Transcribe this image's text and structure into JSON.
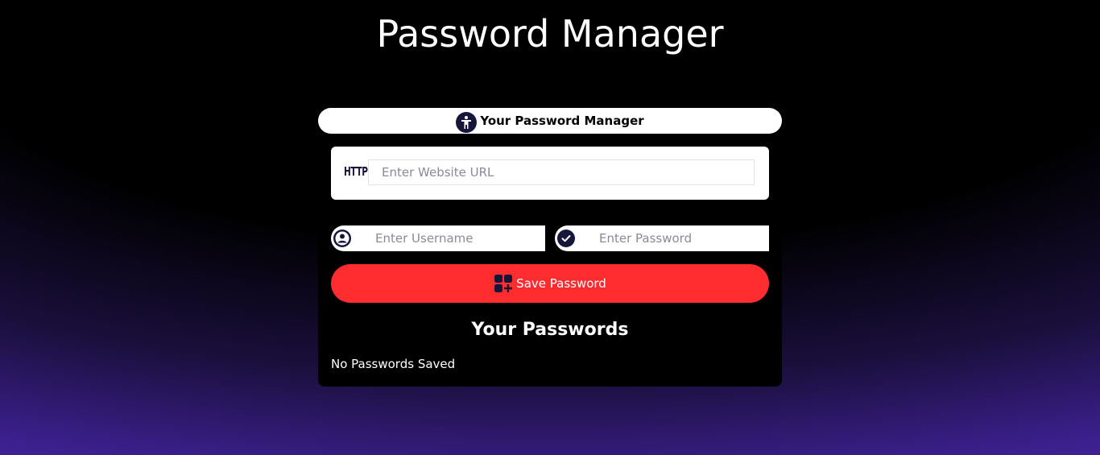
{
  "page": {
    "title": "Password Manager"
  },
  "card": {
    "header_label": "Your Password Manager",
    "header_icon": "person-icon",
    "url": {
      "prefix_label": "HTTP",
      "placeholder": "Enter Website URL",
      "value": ""
    },
    "username": {
      "icon": "user-circle-icon",
      "placeholder": "Enter Username",
      "value": ""
    },
    "password": {
      "icon": "check-circle-icon",
      "placeholder": "Enter Password",
      "value": ""
    },
    "save_button": {
      "label": "Save Password",
      "icon": "add-grid-icon"
    },
    "list_title": "Your Passwords",
    "empty_message": "No Passwords Saved"
  },
  "colors": {
    "accent": "#ff2d2f",
    "icon_dark": "#16163a",
    "gradient_bottom": "#4b24a4"
  }
}
